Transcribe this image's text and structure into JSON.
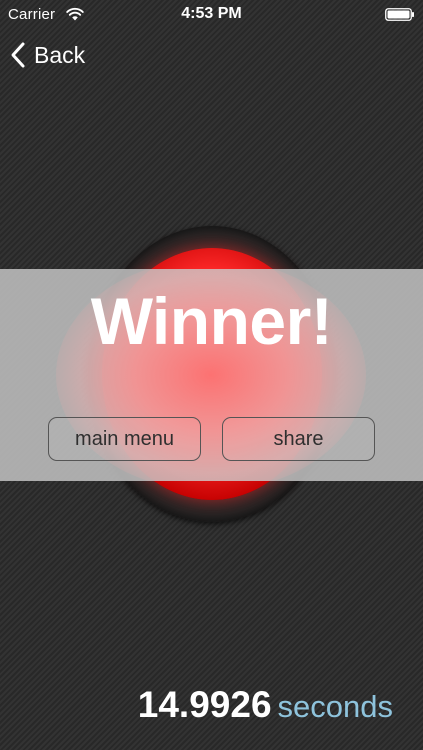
{
  "status_bar": {
    "carrier": "Carrier",
    "time": "4:53 PM",
    "wifi_icon": "wifi-icon",
    "battery_icon": "battery-icon"
  },
  "nav": {
    "back_label": "Back",
    "back_icon": "chevron-left-icon"
  },
  "result": {
    "title": "Winner!",
    "main_menu_label": "main menu",
    "share_label": "share"
  },
  "score": {
    "value": "14.9926",
    "unit": "seconds"
  },
  "colors": {
    "button_red": "#ff2a2a",
    "seconds_blue": "#8ec3dc",
    "banner_gray": "#bebebe"
  }
}
